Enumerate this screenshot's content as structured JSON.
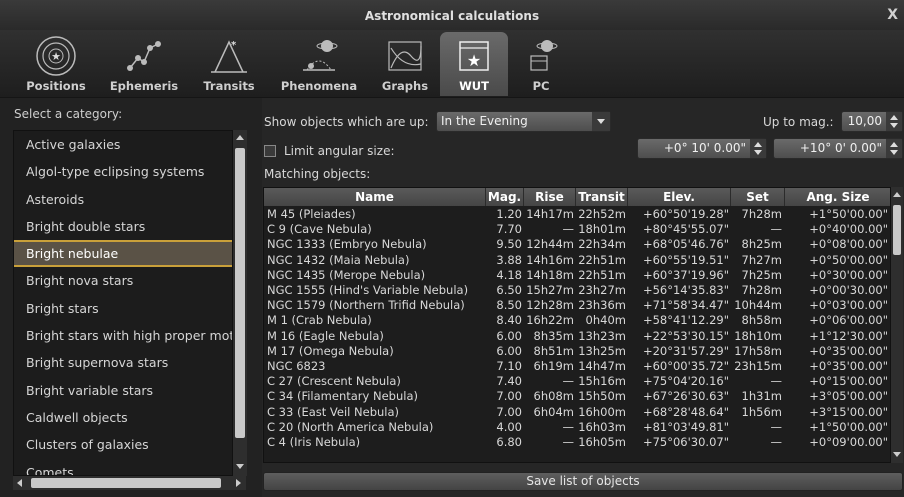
{
  "window": {
    "title": "Astronomical calculations",
    "close_glyph": "X"
  },
  "tabs": [
    {
      "label": "Positions",
      "icon": "positions-icon"
    },
    {
      "label": "Ephemeris",
      "icon": "ephemeris-icon"
    },
    {
      "label": "Transits",
      "icon": "transits-icon"
    },
    {
      "label": "Phenomena",
      "icon": "phenomena-icon"
    },
    {
      "label": "Graphs",
      "icon": "graphs-icon"
    },
    {
      "label": "WUT",
      "icon": "wut-icon",
      "active": true
    },
    {
      "label": "PC",
      "icon": "pc-icon"
    }
  ],
  "left": {
    "label": "Select a category:",
    "categories": [
      "Active galaxies",
      "Algol-type eclipsing systems",
      "Asteroids",
      "Bright double stars",
      "Bright nebulae",
      "Bright nova stars",
      "Bright stars",
      "Bright stars with high proper motion",
      "Bright supernova stars",
      "Bright variable stars",
      "Caldwell objects",
      "Clusters of galaxies",
      "Comets"
    ],
    "selected_index": 4
  },
  "controls": {
    "show_label": "Show objects which are up:",
    "show_value": "In the Evening",
    "upto_label": "Up to mag.:",
    "upto_value": "10,00",
    "limit_label": "Limit angular size:",
    "min_size": "+0° 10' 0.00\"",
    "max_size": "+10° 0' 0.00\"",
    "matching_label": "Matching objects:"
  },
  "table": {
    "columns": [
      "Name",
      "Mag.",
      "Rise",
      "Transit",
      "Elev.",
      "Set",
      "Ang. Size"
    ],
    "rows": [
      [
        "M 45 (Pleiades)",
        "1.20",
        "14h17m",
        "22h52m",
        "+60°50'19.28\"",
        "7h28m",
        "+1°50'00.00\""
      ],
      [
        "C 9 (Cave Nebula)",
        "7.70",
        "—",
        "18h01m",
        "+80°45'55.07\"",
        "—",
        "+0°40'00.00\""
      ],
      [
        "NGC 1333 (Embryo Nebula)",
        "9.50",
        "12h44m",
        "22h34m",
        "+68°05'46.76\"",
        "8h25m",
        "+0°08'00.00\""
      ],
      [
        "NGC 1432 (Maia Nebula)",
        "3.88",
        "14h16m",
        "22h51m",
        "+60°55'19.51\"",
        "7h27m",
        "+0°50'00.00\""
      ],
      [
        "NGC 1435 (Merope Nebula)",
        "4.18",
        "14h18m",
        "22h51m",
        "+60°37'19.96\"",
        "7h25m",
        "+0°30'00.00\""
      ],
      [
        "NGC 1555 (Hind's Variable Nebula)",
        "6.50",
        "15h27m",
        "23h27m",
        "+56°14'35.83\"",
        "7h28m",
        "+0°00'30.00\""
      ],
      [
        "NGC 1579 (Northern Trifid Nebula)",
        "8.50",
        "12h28m",
        "23h36m",
        "+71°58'34.47\"",
        "10h44m",
        "+0°03'00.00\""
      ],
      [
        "M 1 (Crab Nebula)",
        "8.40",
        "16h22m",
        "0h40m",
        "+58°41'12.29\"",
        "8h58m",
        "+0°06'00.00\""
      ],
      [
        "M 16 (Eagle Nebula)",
        "6.00",
        "8h35m",
        "13h23m",
        "+22°53'30.15\"",
        "18h10m",
        "+1°12'30.00\""
      ],
      [
        "M 17 (Omega Nebula)",
        "6.00",
        "8h51m",
        "13h25m",
        "+20°31'57.29\"",
        "17h58m",
        "+0°35'00.00\""
      ],
      [
        "NGC 6823",
        "7.10",
        "6h19m",
        "14h47m",
        "+60°00'35.72\"",
        "23h15m",
        "+0°35'00.00\""
      ],
      [
        "C 27 (Crescent Nebula)",
        "7.40",
        "—",
        "15h16m",
        "+75°04'20.16\"",
        "—",
        "+0°15'00.00\""
      ],
      [
        "C 34 (Filamentary Nebula)",
        "7.00",
        "6h08m",
        "15h50m",
        "+67°26'30.63\"",
        "1h31m",
        "+3°05'00.00\""
      ],
      [
        "C 33 (East Veil Nebula)",
        "7.00",
        "6h04m",
        "16h00m",
        "+68°28'48.64\"",
        "1h56m",
        "+3°15'00.00\""
      ],
      [
        "C 20 (North America Nebula)",
        "4.00",
        "—",
        "16h03m",
        "+81°03'49.81\"",
        "—",
        "+1°50'00.00\""
      ],
      [
        "C 4 (Iris Nebula)",
        "6.80",
        "—",
        "16h05m",
        "+75°06'30.07\"",
        "—",
        "+0°09'00.00\""
      ]
    ]
  },
  "save_label": "Save list of objects"
}
